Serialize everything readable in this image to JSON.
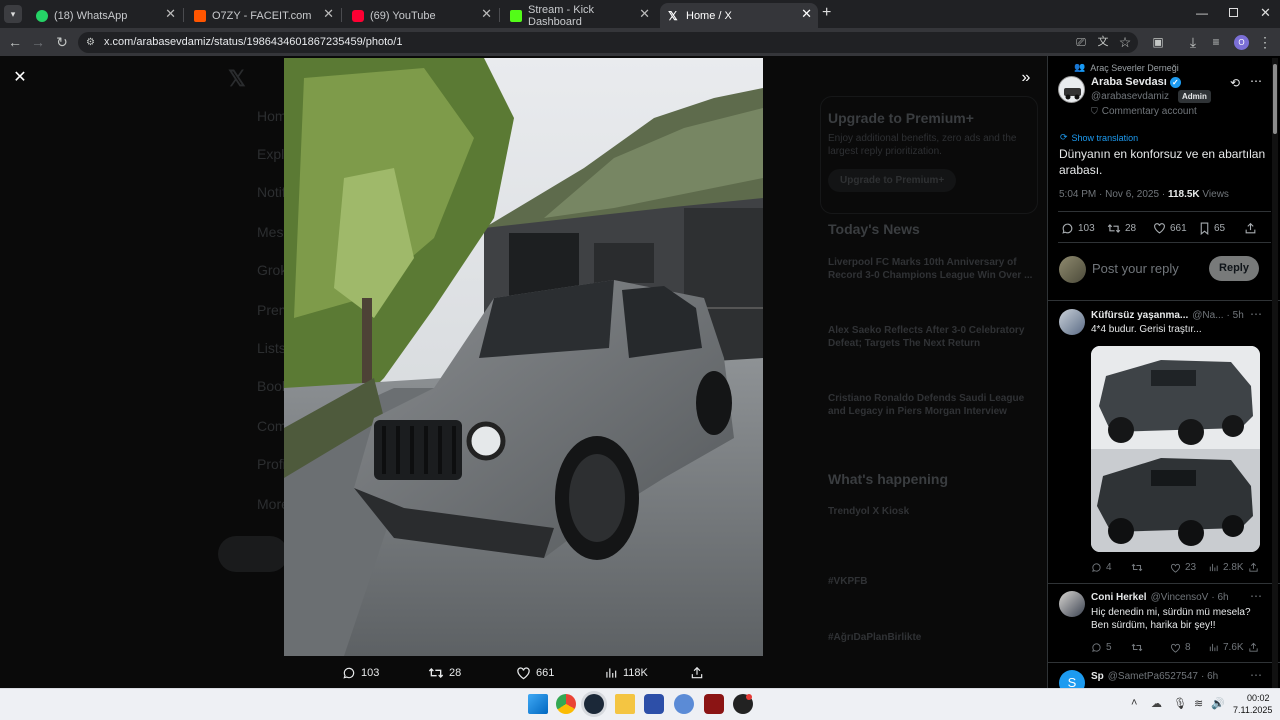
{
  "browser": {
    "tabs": [
      {
        "label": "(18) WhatsApp",
        "icon": "whatsapp-icon",
        "color": "#25d366"
      },
      {
        "label": "O7ZY - FACEIT.com",
        "icon": "faceit-icon",
        "color": "#ff5500"
      },
      {
        "label": "(69) YouTube",
        "icon": "youtube-icon",
        "color": "#ff0033"
      },
      {
        "label": "Stream - Kick Dashboard",
        "icon": "kick-icon",
        "color": "#53fc18"
      },
      {
        "label": "Home / X",
        "icon": "x-icon",
        "color": "#ffffff"
      }
    ],
    "url": "x.com/arabasevdamiz/status/1986434601867235459/photo/1",
    "profile_initial": "O"
  },
  "viewer": {
    "actions": {
      "replies": "103",
      "reposts": "28",
      "likes": "661",
      "views": "118K"
    },
    "background": {
      "premium_title": "Upgrade to Premium+",
      "premium_text": "Enjoy additional benefits, zero ads and the largest reply prioritization.",
      "premium_button": "Upgrade to Premium+",
      "news_title": "Today's News",
      "news": [
        "Liverpool FC Marks 10th Anniversary of Record 3-0 Champions League Win Over ...",
        "Alex Saeko Reflects After 3-0 Celebratory Defeat; Targets The Next Return",
        "Cristiano Ronaldo Defends Saudi League and Legacy in Piers Morgan Interview"
      ],
      "happening_title": "What's happening",
      "happening": [
        "Trendyol X Kiosk",
        "#VKPFB",
        "#AğrıDaPlanBirlikte"
      ],
      "nav": [
        "Home",
        "Explore",
        "Notifications",
        "Messages",
        "Grok",
        "Premium",
        "Lists",
        "Bookmarks",
        "Communities",
        "Profile",
        "More"
      ]
    }
  },
  "side": {
    "community": "Araç Severler Derneği",
    "author_name": "Araba Sevdası",
    "author_handle": "@arabasevdamiz",
    "admin_badge": "Admin",
    "commentary": "Commentary account",
    "show_translation": "Show translation",
    "post_text": "Dünyanın en konforsuz ve en abartılan arabası.",
    "time": "5:04 PM · Nov 6, 2025 · ",
    "views_num": "118.5K",
    "views_label": " Views",
    "stats": {
      "replies": "103",
      "reposts": "28",
      "likes": "661",
      "bookmarks": "65"
    },
    "reply_placeholder": "Post your reply",
    "reply_button": "Reply",
    "replies": [
      {
        "name": "Küfürsüz yaşanma...",
        "handle": "@Na...",
        "time": "· 5h",
        "text": "4*4 budur. Gerisi traştır...",
        "stats": {
          "replies": "4",
          "reposts": "",
          "likes": "23",
          "views": "2.8K"
        }
      },
      {
        "name": "Coni Herkel",
        "handle": "@VincensoV",
        "time": "· 6h",
        "text": "Hiç denedin mi, sürdün mü mesela? Ben sürdüm, harika bir şey!!",
        "stats": {
          "replies": "5",
          "reposts": "",
          "likes": "8",
          "views": "7.6K"
        }
      },
      {
        "name": "Sp",
        "handle": "@SametPa6527547",
        "time": "· 6h",
        "avatar": "S"
      }
    ]
  },
  "taskbar": {
    "time": "00:02",
    "date": "7.11.2025"
  },
  "colors": {
    "accent": "#1d9bf0",
    "reply_button": "#787a7a"
  }
}
